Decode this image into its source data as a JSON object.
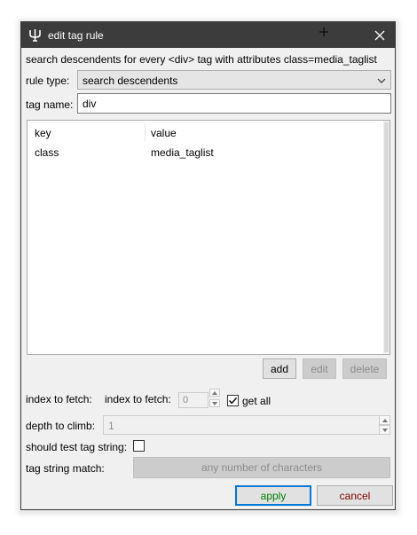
{
  "window": {
    "title": "edit tag rule"
  },
  "description": "search descendents for every <div> tag with attributes class=media_taglist",
  "rule_type": {
    "label": "rule type:",
    "value": "search descendents"
  },
  "tag_name": {
    "label": "tag name:",
    "value": "div"
  },
  "attributes_table": {
    "columns": [
      "key",
      "value"
    ],
    "rows": [
      {
        "key": "class",
        "value": "media_taglist"
      }
    ]
  },
  "table_buttons": {
    "add": "add",
    "edit": "edit",
    "delete": "delete"
  },
  "index_to_fetch": {
    "label": "index to fetch:",
    "inner_label": "index to fetch:",
    "value": "0",
    "get_all_label": "get all",
    "get_all_checked": true
  },
  "depth_to_climb": {
    "label": "depth to climb:",
    "value": "1"
  },
  "should_test_tag_string": {
    "label": "should test tag string:",
    "checked": false
  },
  "tag_string_match": {
    "label": "tag string match:",
    "button": "any number of characters"
  },
  "dialog_buttons": {
    "apply": "apply",
    "cancel": "cancel"
  },
  "colors": {
    "titlebar": "#3c3c3c",
    "apply_text": "#008000",
    "cancel_text": "#800000",
    "default_button_border": "#0078d7"
  }
}
